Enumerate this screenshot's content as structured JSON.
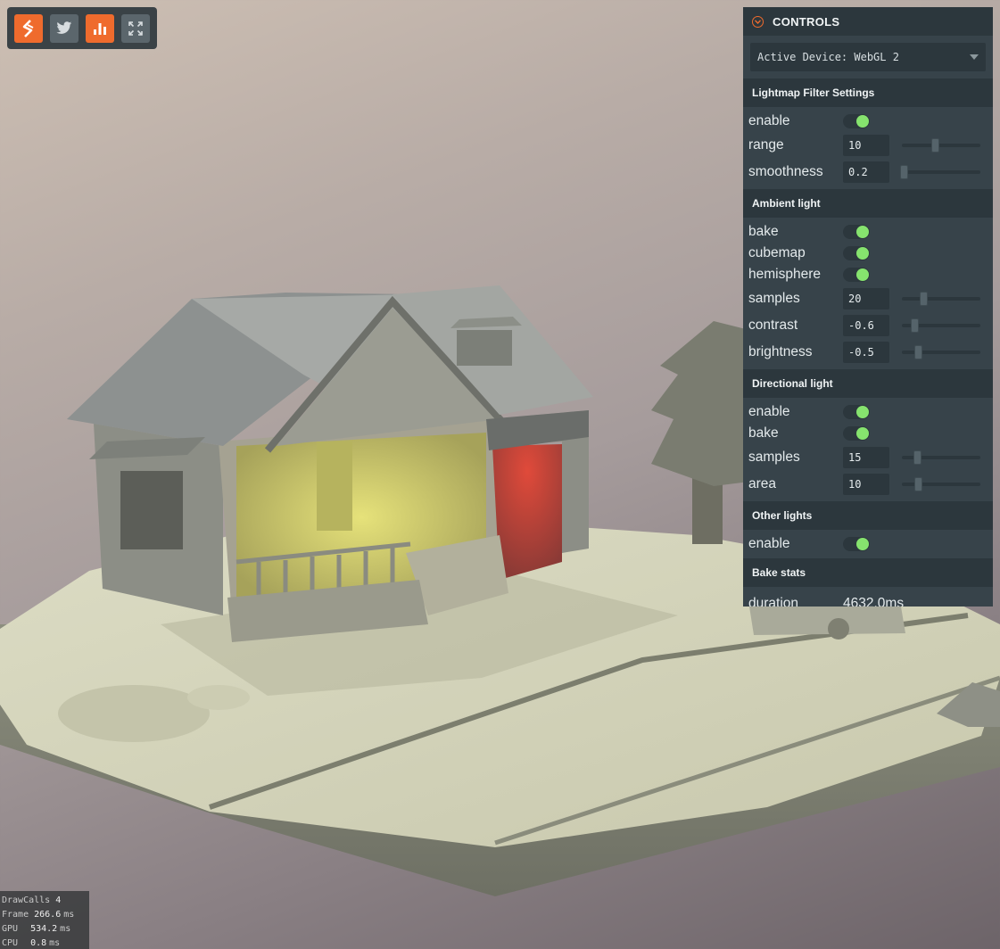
{
  "toolbar": {
    "buttons": [
      {
        "icon": "playcanvas-logo-icon",
        "active": true
      },
      {
        "icon": "twitter-icon",
        "active": false
      },
      {
        "icon": "stats-chart-icon",
        "active": true
      },
      {
        "icon": "fullscreen-icon",
        "active": false
      }
    ]
  },
  "panel": {
    "title": "CONTROLS",
    "device_select": "Active Device: WebGL 2",
    "lightmap": {
      "title": "Lightmap Filter Settings",
      "enable_label": "enable",
      "enable": true,
      "range_label": "range",
      "range_value": "10",
      "range_fraction": 0.42,
      "smoothness_label": "smoothness",
      "smoothness_value": "0.2",
      "smoothness_fraction": 0.02
    },
    "ambient": {
      "title": "Ambient light",
      "bake_label": "bake",
      "bake": true,
      "cubemap_label": "cubemap",
      "cubemap": true,
      "hemisphere_label": "hemisphere",
      "hemisphere": true,
      "samples_label": "samples",
      "samples_value": "20",
      "samples_fraction": 0.27,
      "contrast_label": "contrast",
      "contrast_value": "-0.6",
      "contrast_fraction": 0.16,
      "brightness_label": "brightness",
      "brightness_value": "-0.5",
      "brightness_fraction": 0.2
    },
    "directional": {
      "title": "Directional light",
      "enable_label": "enable",
      "enable": true,
      "bake_label": "bake",
      "bake": true,
      "samples_label": "samples",
      "samples_value": "15",
      "samples_fraction": 0.19,
      "area_label": "area",
      "area_value": "10",
      "area_fraction": 0.2
    },
    "other": {
      "title": "Other lights",
      "enable_label": "enable",
      "enable": true
    },
    "bake_stats": {
      "title": "Bake stats",
      "duration_label": "duration",
      "duration_value": "4632.0ms"
    }
  },
  "stats": {
    "drawcalls_label": "DrawCalls",
    "drawcalls_value": "4",
    "frame_label": "Frame",
    "frame_value": "266.6",
    "frame_unit": "ms",
    "gpu_label": "GPU",
    "gpu_value": "534.2",
    "gpu_unit": "ms",
    "cpu_label": "CPU",
    "cpu_value": "0.8",
    "cpu_unit": "ms"
  },
  "colors": {
    "accent": "#ef6b2d",
    "toggle_on": "#86e36e",
    "panel_bg": "#37434a",
    "panel_header": "#2c373d"
  }
}
